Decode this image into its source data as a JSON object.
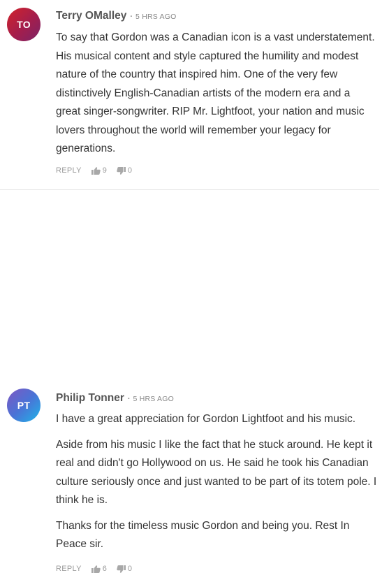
{
  "comments": [
    {
      "initials": "TO",
      "author": "Terry OMalley",
      "separator": "·",
      "time": "5 HRS AGO",
      "paragraphs": [
        "To say that Gordon was a Canadian icon is a vast understatement. His musical content and style captured the humility and modest nature of the country that inspired him. One of the very few distinctively English-Canadian artists of the modern era and a great singer-songwriter. RIP Mr. Lightfoot, your nation and music lovers throughout the world will remember your legacy for generations."
      ],
      "reply_label": "REPLY",
      "upvotes": "9",
      "downvotes": "0"
    },
    {
      "initials": "PT",
      "author": "Philip Tonner",
      "separator": "·",
      "time": "5 HRS AGO",
      "paragraphs": [
        "I have a great appreciation for Gordon Lightfoot and his music.",
        "Aside from his music I like the fact that he stuck around. He kept it real and didn't go Hollywood on us. He said he took his Canadian culture seriously once and just wanted to be part of its totem pole. I think he is.",
        "Thanks for the timeless music Gordon and being you. Rest In Peace sir."
      ],
      "reply_label": "REPLY",
      "upvotes": "6",
      "downvotes": "0"
    }
  ],
  "icons": {
    "thumbs_up": "thumbs-up-icon",
    "thumbs_down": "thumbs-down-icon"
  },
  "colors": {
    "avatar_1_start": "#d2232a",
    "avatar_1_end": "#7b2467",
    "avatar_2_start": "#7e57c2",
    "avatar_2_end": "#1fb4e8",
    "text": "#333333",
    "muted": "#9a9a9a"
  }
}
